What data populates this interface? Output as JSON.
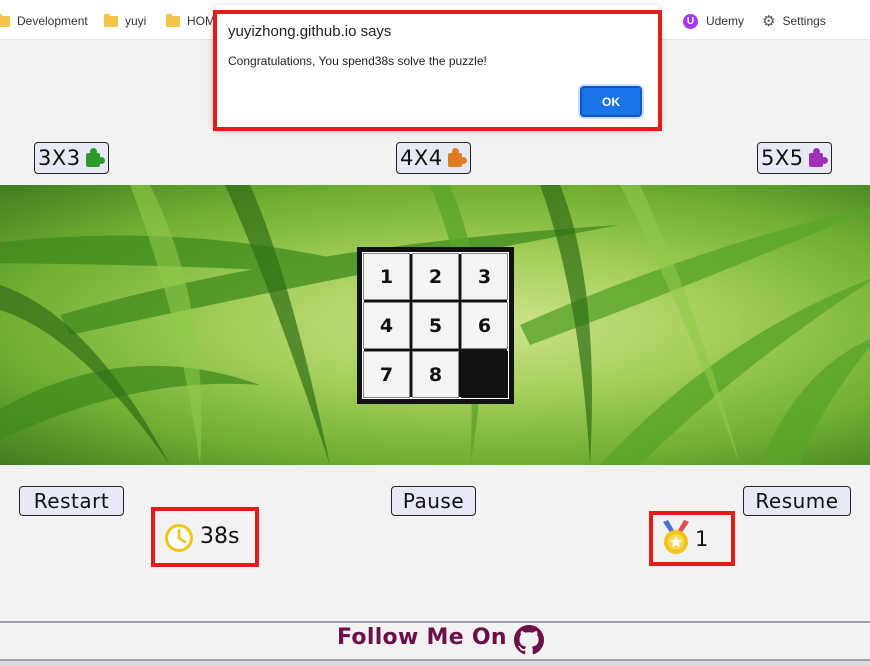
{
  "bookmarks_bar": {
    "items": [
      {
        "label": "Development",
        "icon": "folder-icon"
      },
      {
        "label": "yuyi",
        "icon": "folder-icon"
      },
      {
        "label": "HOM",
        "icon": "folder-icon"
      },
      {
        "label": "Udemy",
        "icon": "udemy-icon"
      },
      {
        "label": "Settings",
        "icon": "gear-icon"
      }
    ]
  },
  "dialog": {
    "title": "yuyizhong.github.io says",
    "message": "Congratulations, You spend38s solve the puzzle!",
    "ok_label": "OK"
  },
  "size_buttons": [
    {
      "label": "3X3",
      "icon": "green-puzzle-icon",
      "color": "#2e9a2e"
    },
    {
      "label": "4X4",
      "icon": "orange-puzzle-icon",
      "color": "#e07b1f"
    },
    {
      "label": "5X5",
      "icon": "purple-puzzle-icon",
      "color": "#a22fb8"
    }
  ],
  "board": {
    "tiles": [
      "1",
      "2",
      "3",
      "4",
      "5",
      "6",
      "7",
      "8",
      ""
    ]
  },
  "controls": {
    "restart_label": "Restart",
    "pause_label": "Pause",
    "resume_label": "Resume"
  },
  "stats": {
    "timer": "38s",
    "timer_icon": "clock-icon",
    "moves": "1",
    "medal_icon": "medal-icon"
  },
  "footer": {
    "text": "Follow Me On",
    "icon": "github-icon"
  },
  "colors": {
    "highlight": "#e21b1b",
    "ok_button": "#1a73e8",
    "footer_text": "#6b1048",
    "timer_icon": "#f0c419"
  }
}
